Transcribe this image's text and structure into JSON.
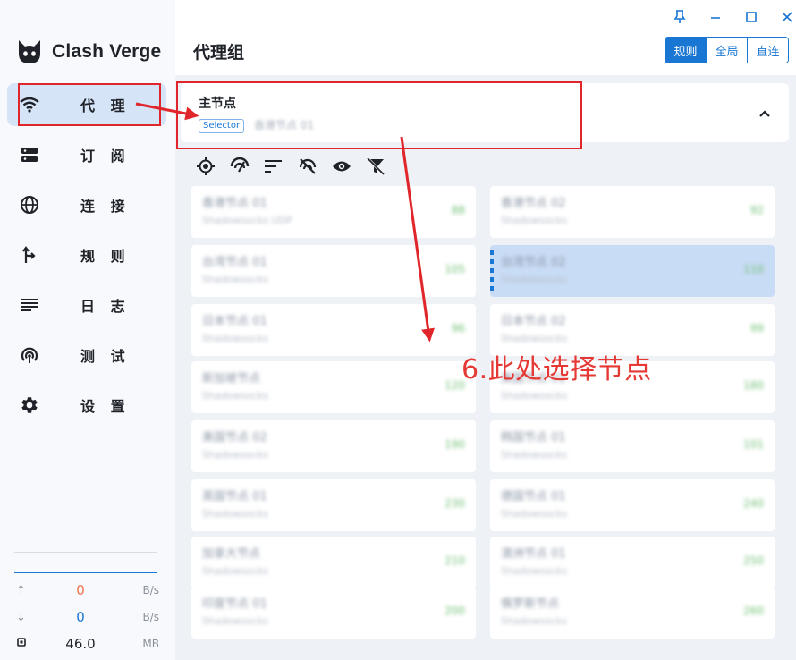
{
  "app": {
    "name": "Clash Verge"
  },
  "sidebar": {
    "items": [
      {
        "label": "代 理",
        "icon": "wifi-icon",
        "active": true
      },
      {
        "label": "订 阅",
        "icon": "dns-icon",
        "active": false
      },
      {
        "label": "连 接",
        "icon": "globe-icon",
        "active": false
      },
      {
        "label": "规 则",
        "icon": "fork-arrow-icon",
        "active": false
      },
      {
        "label": "日 志",
        "icon": "list-icon",
        "active": false
      },
      {
        "label": "测 试",
        "icon": "signal-icon",
        "active": false
      },
      {
        "label": "设 置",
        "icon": "gear-icon",
        "active": false
      }
    ],
    "traffic": {
      "upload": {
        "value": "0",
        "unit": "B/s",
        "color": "#f4734c"
      },
      "download": {
        "value": "0",
        "unit": "B/s",
        "color": "#1976d2"
      },
      "memory": {
        "value": "46.0",
        "unit": "MB"
      }
    }
  },
  "header": {
    "title": "代理组",
    "modes": [
      {
        "label": "规则",
        "active": true
      },
      {
        "label": "全局",
        "active": false
      },
      {
        "label": "直连",
        "active": false
      }
    ]
  },
  "group": {
    "name": "主节点",
    "type": "Selector",
    "current": "香港节点 01"
  },
  "toolbar": {
    "icons": [
      "locate-icon",
      "speed-test-icon",
      "sort-icon",
      "latency-off-icon",
      "eye-icon",
      "filter-off-icon"
    ]
  },
  "nodes": [
    {
      "name": "香港节点 01",
      "type": "Shadowsocks UDP",
      "delay": "88"
    },
    {
      "name": "香港节点 02",
      "type": "Shadowsocks",
      "delay": "92"
    },
    {
      "name": "台湾节点 01",
      "type": "Shadowsocks",
      "delay": "105"
    },
    {
      "name": "台湾节点 02",
      "type": "Shadowsocks",
      "delay": "110",
      "selected": true
    },
    {
      "name": "日本节点 01",
      "type": "Shadowsocks",
      "delay": "96"
    },
    {
      "name": "日本节点 02",
      "type": "Shadowsocks",
      "delay": "99"
    },
    {
      "name": "新加坡节点",
      "type": "Shadowsocks",
      "delay": "120"
    },
    {
      "name": "美国节点 01",
      "type": "Shadowsocks",
      "delay": "180"
    },
    {
      "name": "美国节点 02",
      "type": "Shadowsocks",
      "delay": "190"
    },
    {
      "name": "韩国节点 01",
      "type": "Shadowsocks",
      "delay": "101"
    },
    {
      "name": "英国节点 01",
      "type": "Shadowsocks",
      "delay": "230"
    },
    {
      "name": "德国节点 01",
      "type": "Shadowsocks",
      "delay": "240"
    },
    {
      "name": "加拿大节点",
      "type": "Shadowsocks",
      "delay": "210"
    },
    {
      "name": "澳洲节点 01",
      "type": "Shadowsocks",
      "delay": "250"
    },
    {
      "name": "印度节点 01",
      "type": "Shadowsocks",
      "delay": "200"
    },
    {
      "name": "俄罗斯节点",
      "type": "Shadowsocks",
      "delay": "260"
    }
  ],
  "annotation": {
    "text": "6.此处选择节点",
    "color": "#e53935"
  }
}
